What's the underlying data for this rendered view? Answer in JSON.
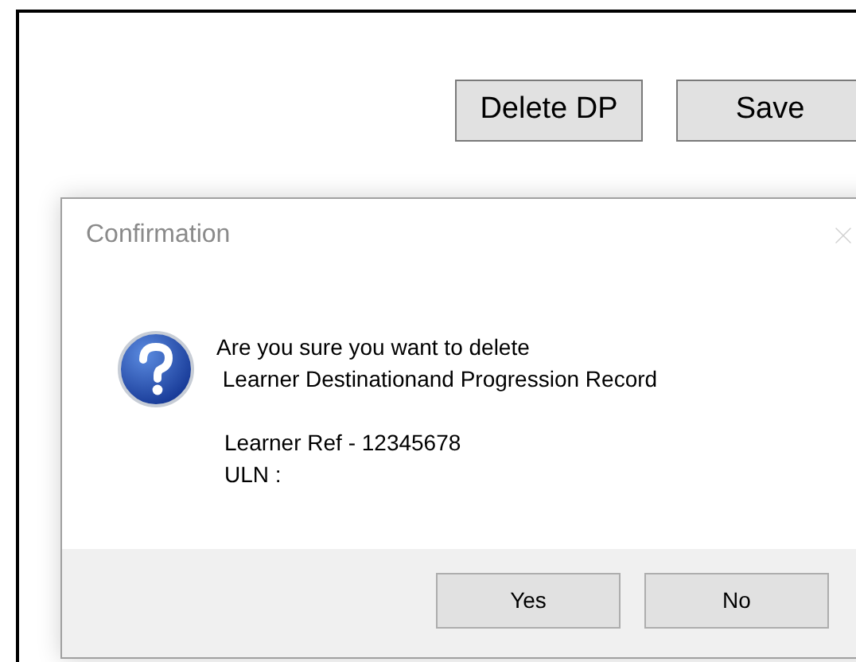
{
  "toolbar": {
    "buttons": [
      "Delete DP",
      "Save"
    ]
  },
  "dialog": {
    "title": "Confirmation",
    "close_disabled": true,
    "message": [
      "Are you sure you want to delete",
      " Learner Destinationand Progression Record"
    ],
    "details": [
      "Learner Ref - 12345678",
      "ULN :"
    ],
    "buttons": [
      "Yes",
      "No"
    ]
  }
}
